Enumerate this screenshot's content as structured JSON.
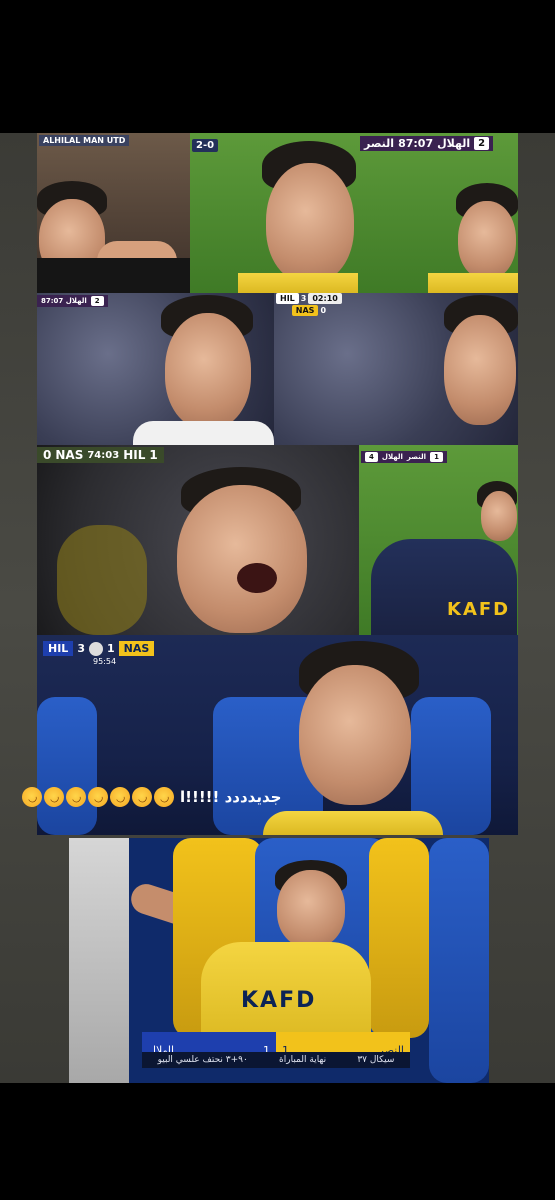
{
  "caption": {
    "text": "جديدددد !!!!!ا",
    "emoji_count": 7,
    "emoji_icon": "rofl-emoji"
  },
  "row1": {
    "p1_bug": "ALHILAL MAN UTD",
    "p3_bug_time": "87:07",
    "p3_bug_team1": "الهلال",
    "p3_bug_score": "2",
    "p3_bug_team2": "النصر"
  },
  "row2": {
    "bug_team1": "HIL",
    "bug_score1": "3",
    "bug_team2": "NAS",
    "bug_score2": "0",
    "bug_time": "02:10"
  },
  "row3": {
    "bug_score1": "0",
    "bug_team1": "NAS",
    "bug_time": "74:03",
    "bug_team2": "HIL",
    "bug_score2": "1",
    "right_bug_team1": "النصر",
    "right_bug_team2": "الهلال",
    "right_bug_score1": "1",
    "right_bug_score2": "4"
  },
  "row4": {
    "bug_team1": "HIL",
    "bug_score1": "3",
    "bug_score2": "1",
    "bug_team2": "NAS",
    "bug_time": "95:54"
  },
  "row5": {
    "shirt_text": "KAFD",
    "bottom_left_team": "الهلال",
    "bottom_left_score": "1",
    "bottom_right_team": "النصر",
    "bottom_right_score": "1",
    "bottom_sub_left": "٩٠+٣ نحتف علسي البيو",
    "bottom_sub_mid": "نهاية المباراة",
    "bottom_sub_right": "سيكال ٣٧"
  },
  "colors": {
    "nassr_yellow": "#f2c21b",
    "nassr_navy": "#0c2355",
    "hilal_blue": "#1e3fae"
  }
}
